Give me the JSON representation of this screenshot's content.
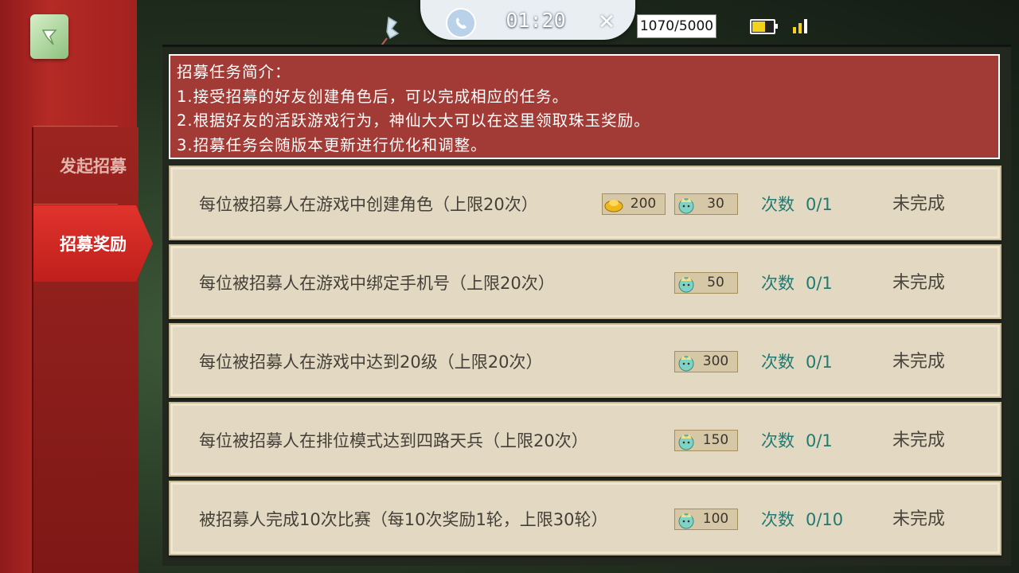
{
  "top_bar": {
    "timer": "01:20",
    "score": "1070/5000",
    "battery_level": 0.6
  },
  "sidebar": {
    "items": [
      {
        "label": "发起招募",
        "active": false
      },
      {
        "label": "招募奖励",
        "active": true
      }
    ]
  },
  "intro": {
    "title": "招募任务简介：",
    "lines": [
      "1.接受招募的好友创建角色后，可以完成相应的任务。",
      "2.根据好友的活跃游戏行为，神仙大大可以在这里领取珠玉奖励。",
      "3.招募任务会随版本更新进行优化和调整。"
    ]
  },
  "count_label": "次数",
  "tasks": [
    {
      "desc": "每位被招募人在游戏中创建角色（上限20次）",
      "gold": "200",
      "jade": "30",
      "count": "0/1",
      "status": "未完成"
    },
    {
      "desc": "每位被招募人在游戏中绑定手机号（上限20次）",
      "jade": "50",
      "count": "0/1",
      "status": "未完成"
    },
    {
      "desc": "每位被招募人在游戏中达到20级（上限20次）",
      "jade": "300",
      "count": "0/1",
      "status": "未完成"
    },
    {
      "desc": "每位被招募人在排位模式达到四路天兵（上限20次）",
      "jade": "150",
      "count": "0/1",
      "status": "未完成"
    },
    {
      "desc": "被招募人完成10次比赛（每10次奖励1轮，上限30轮）",
      "jade": "100",
      "count": "0/10",
      "status": "未完成"
    }
  ],
  "colors": {
    "intro_bg": "#a23a35",
    "task_bg": "#e3d9c3",
    "count_text": "#1f7a72",
    "active_tab": "#d32a25"
  }
}
